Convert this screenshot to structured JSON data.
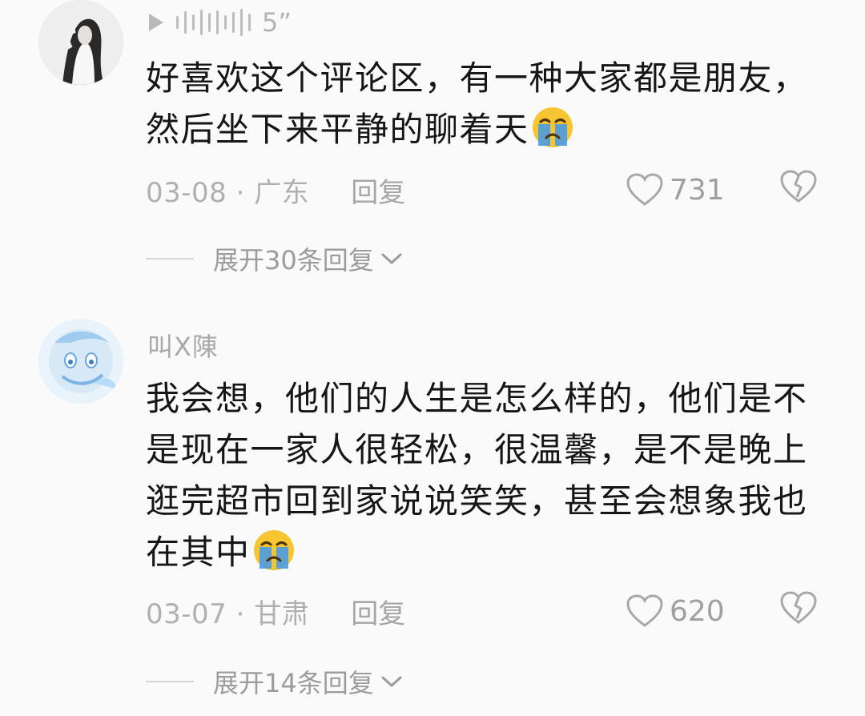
{
  "comments": [
    {
      "voice_duration": "5”",
      "text": "好喜欢这个评论区，有一种大家都是朋友，然后坐下来平静的聊着天",
      "emoji": "crying-face",
      "date_location": "03-08 · 广东",
      "reply_label": "回复",
      "likes": "731",
      "expand_label": "展开30条回复"
    },
    {
      "username": "叫X陳",
      "text": "我会想，他们的人生是怎么样的，他们是不是现在一家人很轻松，很温馨，是不是晚上逛完超市回到家说说笑笑，甚至会想象我也在其中",
      "emoji": "crying-face",
      "date_location": "03-07 · 甘肃",
      "reply_label": "回复",
      "likes": "620",
      "expand_label": "展开14条回复"
    }
  ],
  "colors": {
    "background": "#fafafa",
    "text": "#161616",
    "muted": "#b0b0b0",
    "emoji": "#f7c531",
    "tears": "#4a9be6"
  }
}
